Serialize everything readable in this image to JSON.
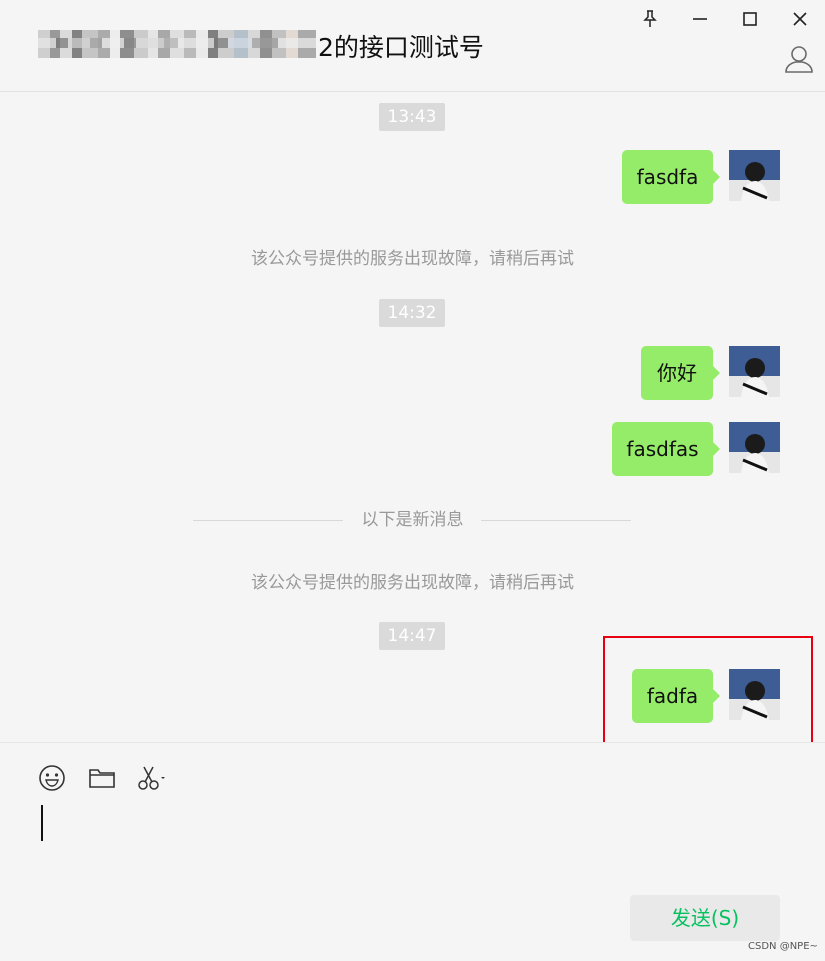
{
  "window": {
    "title": "2的接口测试号"
  },
  "messages": {
    "times": [
      "13:43",
      "14:32",
      "14:47"
    ],
    "system_notice": "该公众号提供的服务出现故障，请稍后再试",
    "new_divider": "以下是新消息",
    "outgoing": [
      "fasdfa",
      "你好",
      "fasdfas",
      "fadfa"
    ]
  },
  "composer": {
    "send_label": "发送(S)"
  },
  "watermark": "CSDN @NPE~",
  "colors": {
    "bubble": "#95ec69",
    "send_text": "#07c160",
    "highlight": "#e60012"
  }
}
